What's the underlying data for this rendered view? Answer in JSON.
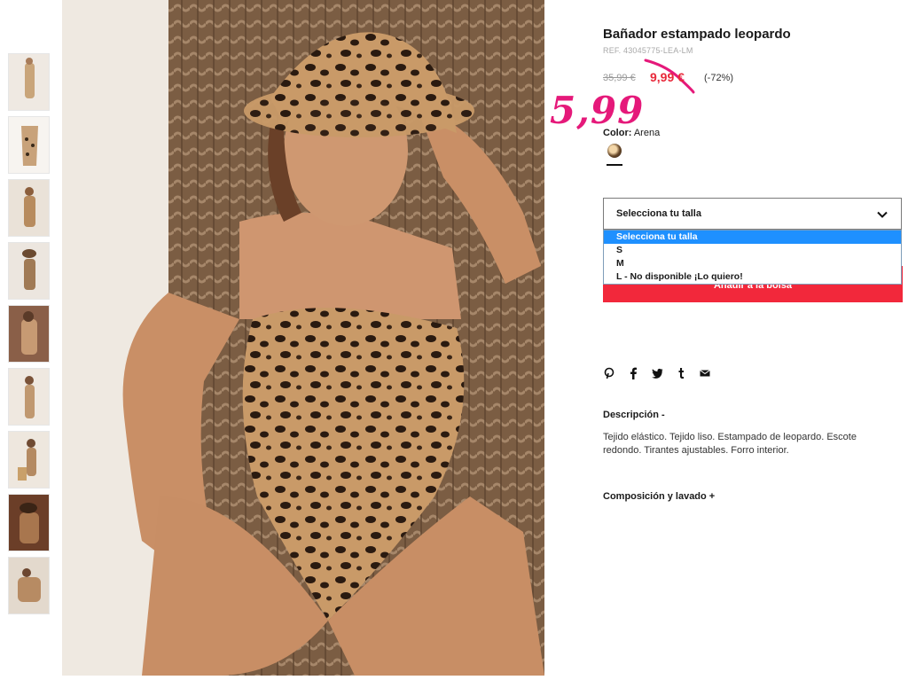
{
  "product": {
    "title": "Bañador estampado leopardo",
    "ref": "REF. 43045775-LEA-LM",
    "old_price": "35,99 €",
    "new_price": "9,99 €",
    "discount": "(-72%)",
    "annotation_price": "5,99",
    "color_label": "Color:",
    "color_value": "Arena"
  },
  "size_select": {
    "label": "Selecciona tu talla",
    "options": [
      "Selecciona tu talla",
      "S",
      "M",
      "L - No disponible ¡Lo quiero!"
    ]
  },
  "add_button": "Añadir a la bolsa",
  "share_icons": [
    "pinterest-icon",
    "facebook-icon",
    "twitter-icon",
    "tumblr-icon",
    "mail-icon"
  ],
  "description": {
    "heading": "Descripción -",
    "text": "Tejido elástico. Tejido liso. Estampado de leopardo. Escote redondo. Tirantes ajustables. Forro interior."
  },
  "composition": {
    "heading": "Composición y lavado +"
  },
  "colors": {
    "price_red": "#e8283a",
    "button_red": "#f2283b",
    "annotation_pink": "#e5197a",
    "select_blue": "#1e90ff"
  }
}
